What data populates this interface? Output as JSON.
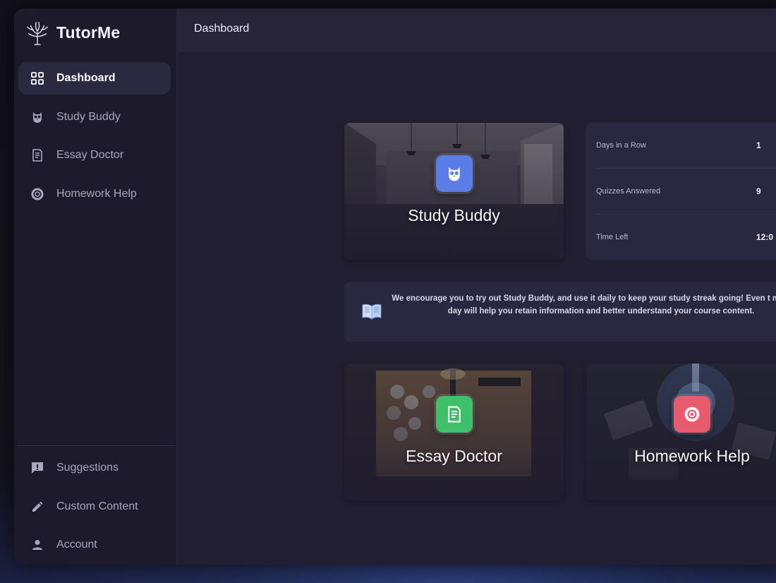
{
  "app": {
    "name": "TutorMe"
  },
  "sidebar": {
    "items": [
      {
        "label": "Dashboard",
        "icon": "grid-icon",
        "active": true
      },
      {
        "label": "Study Buddy",
        "icon": "owl-icon",
        "active": false
      },
      {
        "label": "Essay Doctor",
        "icon": "document-icon",
        "active": false
      },
      {
        "label": "Homework Help",
        "icon": "lifebuoy-icon",
        "active": false
      }
    ],
    "bottom_items": [
      {
        "label": "Suggestions",
        "icon": "feedback-icon"
      },
      {
        "label": "Custom Content",
        "icon": "pencil-icon"
      },
      {
        "label": "Account",
        "icon": "user-icon"
      }
    ]
  },
  "header": {
    "title": "Dashboard"
  },
  "tiles": {
    "study_buddy": {
      "label": "Study Buddy",
      "icon": "owl-icon",
      "color": "#5b7de8"
    },
    "essay_doctor": {
      "label": "Essay Doctor",
      "icon": "document-icon",
      "color": "#3fbf6a"
    },
    "homework_help": {
      "label": "Homework Help",
      "icon": "lifebuoy-icon",
      "color": "#e85a6e"
    }
  },
  "stats": {
    "days_in_row": {
      "label": "Days in a Row",
      "value": "1"
    },
    "quizzes_answered": {
      "label": "Quizzes Answered",
      "value": "9"
    },
    "time_left": {
      "label": "Time Left",
      "value": "12:0"
    }
  },
  "notice": {
    "icon": "open-book-icon",
    "text": "We encourage you to try out Study Buddy, and use it daily to keep your study streak going! Even t minutes a day will help you retain information and better understand your course content."
  }
}
